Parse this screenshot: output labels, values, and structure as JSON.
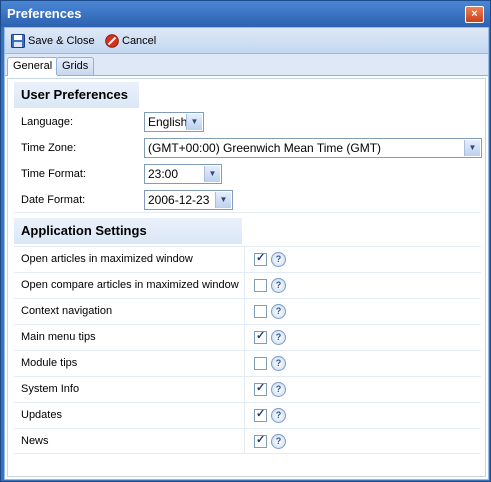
{
  "window": {
    "title": "Preferences"
  },
  "toolbar": {
    "save_label": "Save & Close",
    "cancel_label": "Cancel"
  },
  "tabs": [
    {
      "label": "General",
      "active": true
    },
    {
      "label": "Grids",
      "active": false
    }
  ],
  "user_preferences": {
    "header": "User Preferences",
    "language": {
      "label": "Language:",
      "value": "English"
    },
    "time_zone": {
      "label": "Time Zone:",
      "value": "(GMT+00:00) Greenwich Mean Time (GMT)"
    },
    "time_format": {
      "label": "Time Format:",
      "value": "23:00"
    },
    "date_format": {
      "label": "Date Format:",
      "value": "2006-12-23"
    }
  },
  "application_settings": {
    "header": "Application Settings",
    "items": [
      {
        "label": "Open articles in maximized window",
        "checked": true
      },
      {
        "label": "Open compare articles in maximized window",
        "checked": false
      },
      {
        "label": "Context navigation",
        "checked": false
      },
      {
        "label": "Main menu tips",
        "checked": true
      },
      {
        "label": "Module tips",
        "checked": false
      },
      {
        "label": "System Info",
        "checked": true
      },
      {
        "label": "Updates",
        "checked": true
      },
      {
        "label": "News",
        "checked": true
      }
    ],
    "help_symbol": "?"
  },
  "colors": {
    "titlebar": "#2d62b0",
    "toolbar": "#c3d8f1",
    "accent": "#99bbe8"
  }
}
